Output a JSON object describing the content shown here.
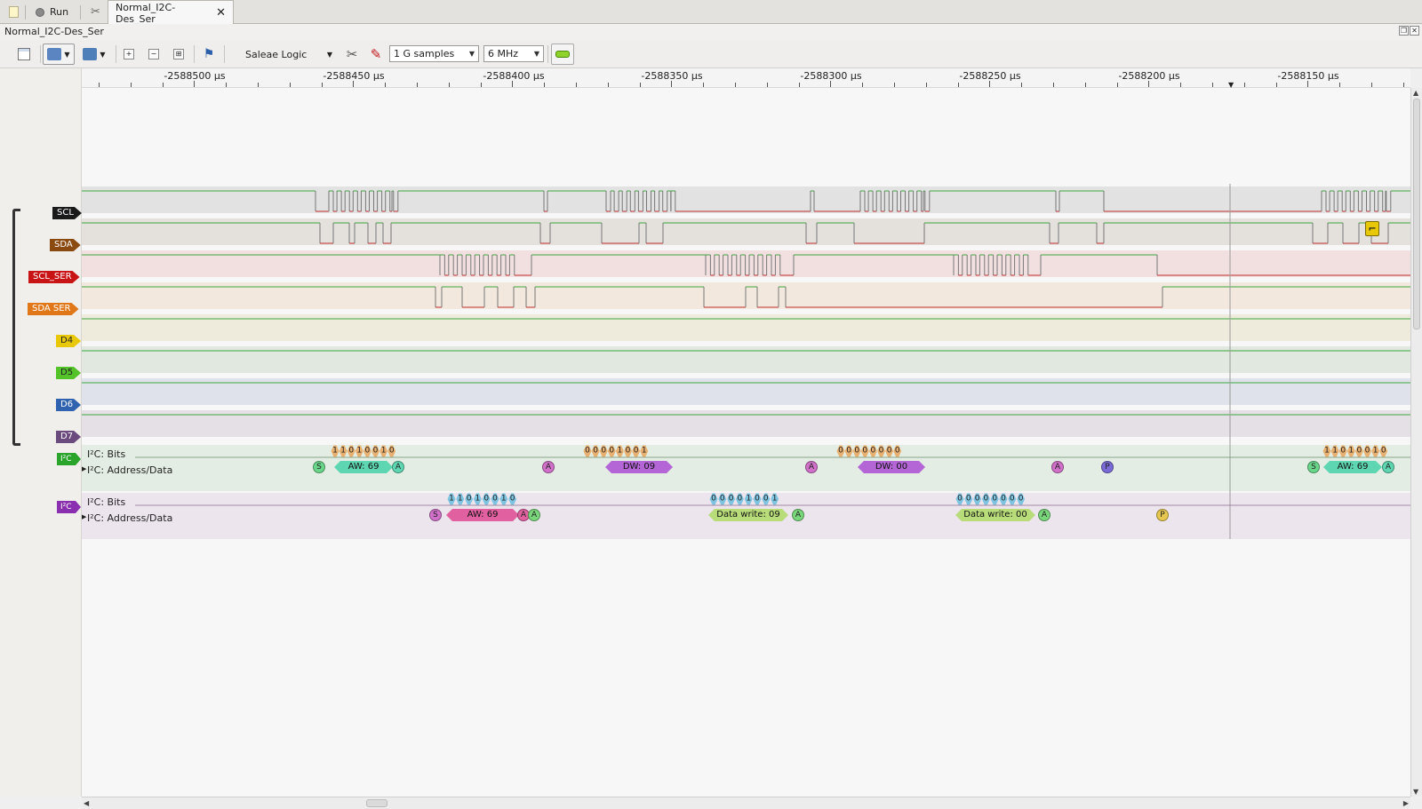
{
  "tabs": [
    {
      "label": "",
      "icon": "new-document-icon"
    },
    {
      "label": "Run",
      "icon": "record-circle-icon"
    },
    {
      "label": "",
      "icon": "tools-icon"
    },
    {
      "label": "Normal_I2C-Des_Ser",
      "icon": "close-icon",
      "active": true
    }
  ],
  "session": {
    "title": "Normal_I2C-Des_Ser"
  },
  "toolbar": {
    "device": "Saleae Logic",
    "samples": "1 G samples",
    "rate": "6 MHz",
    "icons": [
      "new-icon",
      "open-icon",
      "save-icon",
      "zoom-in-icon",
      "zoom-out-icon",
      "zoom-fit-icon",
      "marker-flags-icon",
      "device-settings-icon",
      "probe-icon",
      "trigger-icon"
    ]
  },
  "ruler": {
    "unit": "µs",
    "labels": [
      "-2588500 µs",
      "-2588450 µs",
      "-2588400 µs",
      "-2588350 µs",
      "-2588300 µs",
      "-2588250 µs",
      "-2588200 µs",
      "-2588150 µs"
    ]
  },
  "channels": [
    {
      "name": "SCL",
      "color": "#1a1a1a",
      "band": "#e2e2e2"
    },
    {
      "name": "SDA",
      "color": "#8a4a10",
      "band": "#e4e0dc"
    },
    {
      "name": "SCL_SER",
      "color": "#c81414",
      "band": "#f2e0e0"
    },
    {
      "name": "SDA SER",
      "color": "#e0781a",
      "band": "#f3e8de"
    },
    {
      "name": "D4",
      "color": "#e8c800",
      "band": "#eeebdc"
    },
    {
      "name": "D5",
      "color": "#54c32a",
      "band": "#e0e8df"
    },
    {
      "name": "D6",
      "color": "#2f63b0",
      "band": "#dfe2ea"
    },
    {
      "name": "D7",
      "color": "#6b4a7d",
      "band": "#e4e0e6"
    }
  ],
  "analyzers": [
    {
      "badge": "I²C",
      "color": "#2aa42a",
      "band": "#e3ede3",
      "bits_label": "I²C: Bits",
      "data_label": "I²C: Address/Data",
      "bits": [
        "1",
        "1",
        "0",
        "1",
        "0",
        "0",
        "1",
        "0",
        "0",
        "0",
        "0",
        "0",
        "1",
        "0",
        "0",
        "1",
        "0",
        "0",
        "0",
        "0",
        "0",
        "0",
        "0",
        "0",
        "1",
        "1",
        "0",
        "1",
        "0",
        "0",
        "1",
        "0"
      ],
      "frames": [
        "S",
        "AW: 69",
        "A",
        "A",
        "DW: 09",
        "A",
        "DW: 00",
        "A",
        "P",
        "S",
        "AW: 69",
        "A"
      ]
    },
    {
      "badge": "I²C",
      "color": "#8a2fb0",
      "band": "#ede5ee",
      "bits_label": "I²C: Bits",
      "data_label": "I²C: Address/Data",
      "bits": [
        "1",
        "1",
        "0",
        "1",
        "0",
        "0",
        "1",
        "0",
        "0",
        "0",
        "0",
        "0",
        "1",
        "0",
        "0",
        "1",
        "0",
        "0",
        "0",
        "0",
        "0",
        "0",
        "0",
        "0"
      ],
      "frames": [
        "S",
        "AW: 69",
        "A",
        "A",
        "Data write: 09",
        "A",
        "Data write: 00",
        "A",
        "P"
      ]
    }
  ]
}
